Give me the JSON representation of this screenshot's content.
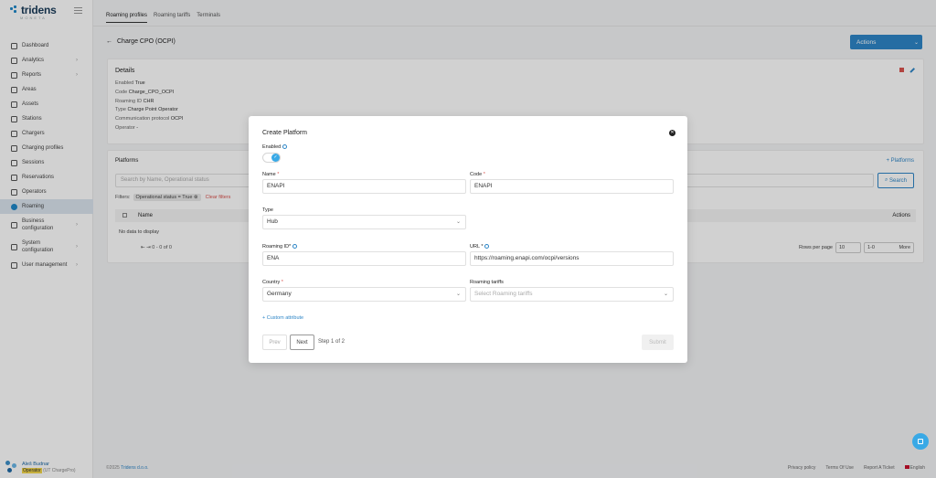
{
  "brand": {
    "name": "tridens",
    "sub": "MONETA"
  },
  "sidebar": {
    "items": [
      {
        "label": "Dashboard"
      },
      {
        "label": "Analytics"
      },
      {
        "label": "Reports"
      },
      {
        "label": "Areas"
      },
      {
        "label": "Assets"
      },
      {
        "label": "Stations"
      },
      {
        "label": "Chargers"
      },
      {
        "label": "Charging profiles"
      },
      {
        "label": "Sessions"
      },
      {
        "label": "Reservations"
      },
      {
        "label": "Operators"
      },
      {
        "label": "Roaming"
      },
      {
        "label": "Business",
        "label2": "configuration"
      },
      {
        "label": "System",
        "label2": "configuration"
      },
      {
        "label": "User management"
      }
    ],
    "chevron": "›",
    "user": {
      "name": "Aleš Budnar",
      "role_badge": "Operator",
      "role_rest": "(UT ChargePro)"
    }
  },
  "tabs": [
    "Roaming profiles",
    "Roaming tariffs",
    "Terminals"
  ],
  "page": {
    "back_icon": "←",
    "title": "Charge CPO (OCPI)",
    "actions_label": "Actions",
    "actions_chevron": "⌄"
  },
  "details": {
    "title": "Details",
    "rows": [
      {
        "k": "Enabled",
        "v": "True"
      },
      {
        "k": "Code",
        "v": "Charge_CPO_OCPI"
      },
      {
        "k": "Roaming ID",
        "v": "CHR"
      },
      {
        "k": "Type",
        "v": "Charge Point Operator"
      },
      {
        "k": "Communication protocol",
        "v": "OCPI"
      },
      {
        "k": "Operator",
        "v": "-"
      }
    ]
  },
  "platforms": {
    "title": "Platforms",
    "add_label": "+ Platforms",
    "search_placeholder": "Search by Name, Operational status",
    "search_button": "Search",
    "filters_label": "Filters:",
    "filter_chip": "Operational status = True",
    "chip_close": "⊗",
    "clear_filters": "Clear filters",
    "col_name": "Name",
    "col_actions": "Actions",
    "no_data": "No data to display",
    "pager_text": "⇤   ⇥  0 - 0 of 0",
    "rows_per_page_label": "Rows per page",
    "rows_per_page_value": "10",
    "page_range": "1-0",
    "more": "More"
  },
  "footer": {
    "copyright": "©2025",
    "company": "Tridens d.o.o.",
    "links": [
      "Privacy policy",
      "Terms Of Use",
      "Report A Ticket",
      "English"
    ]
  },
  "modal": {
    "title": "Create Platform",
    "close_icon": "✕",
    "enabled_label": "Enabled",
    "toggle_check": "✓",
    "name_label": "Name",
    "name_value": "ENAPI",
    "code_label": "Code",
    "code_value": "ENAPI",
    "type_label": "Type",
    "type_value": "Hub",
    "roaming_id_label": "Roaming ID*",
    "roaming_id_value": "ENA",
    "url_label": "URL *",
    "url_value": "https://roaming.enapi.com/ocpi/versions",
    "country_label": "Country",
    "country_value": "Germany",
    "tariffs_label": "Roaming tariffs",
    "tariffs_placeholder": "Select Roaming tariffs",
    "required_mark": "*",
    "select_arrow": "⌄",
    "custom_attribute": "+ Custom attribute",
    "prev": "Prev",
    "next": "Next",
    "step": "Step 1 of 2",
    "submit": "Submit"
  }
}
